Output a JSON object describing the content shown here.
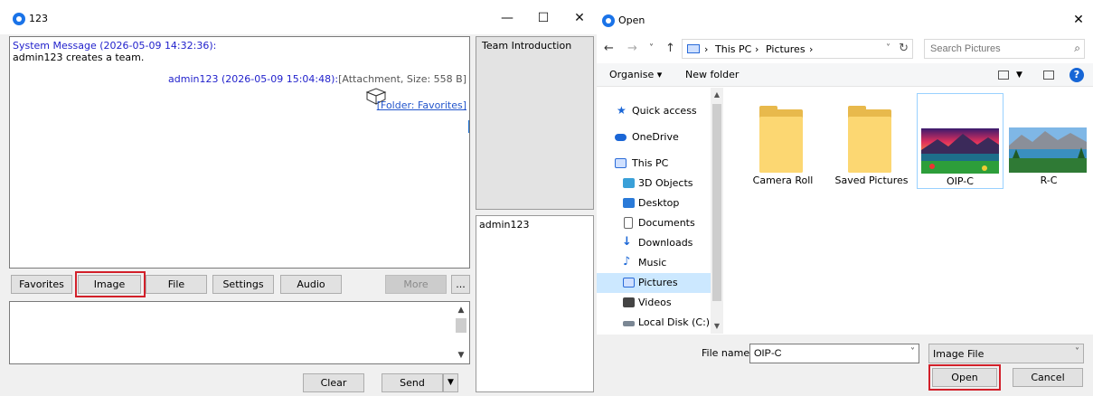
{
  "chat_window": {
    "title": "123",
    "controls": {
      "minimize": "—",
      "maximize": "☐",
      "close": "✕"
    },
    "messages": [
      {
        "header": "System Message (2026-05-09 14:32:36):",
        "body": "admin123 creates a team."
      },
      {
        "sender": "admin123 (2026-05-09 15:04:48):",
        "attachment": "[Attachment, Size: 558 B]",
        "link": "[Folder: Favorites]"
      }
    ],
    "toolbar": {
      "favorites": "Favorites",
      "image": "Image",
      "file": "File",
      "settings": "Settings",
      "audio": "Audio",
      "more": "More",
      "ellipsis": "..."
    },
    "buttons": {
      "clear": "Clear",
      "send": "Send",
      "send_dropdown": "▼"
    },
    "side_panel": {
      "top": "Team Introduction",
      "member": "admin123"
    },
    "highlight_color": "#d2202a"
  },
  "open_dialog": {
    "title": "Open",
    "close": "✕",
    "nav": {
      "back": "←",
      "forward": "→",
      "recent": "˅",
      "up": "↑"
    },
    "breadcrumb": [
      "This PC",
      "Pictures"
    ],
    "breadcrumb_sep": "›",
    "search_placeholder": "Search Pictures",
    "commands": {
      "organise": "Organise ▾",
      "new_folder": "New folder"
    },
    "tree": [
      {
        "label": "Quick access",
        "icon": "star-icon"
      },
      {
        "label": "OneDrive",
        "icon": "cloud-icon"
      },
      {
        "label": "This PC",
        "icon": "computer-icon"
      },
      {
        "label": "3D Objects",
        "icon": "cube-icon"
      },
      {
        "label": "Desktop",
        "icon": "desktop-icon"
      },
      {
        "label": "Documents",
        "icon": "document-icon"
      },
      {
        "label": "Downloads",
        "icon": "download-icon"
      },
      {
        "label": "Music",
        "icon": "music-icon"
      },
      {
        "label": "Pictures",
        "icon": "pictures-icon",
        "selected": true
      },
      {
        "label": "Videos",
        "icon": "video-icon"
      },
      {
        "label": "Local Disk (C:)",
        "icon": "disk-icon"
      }
    ],
    "files": [
      {
        "name": "Camera Roll",
        "kind": "folder"
      },
      {
        "name": "Saved Pictures",
        "kind": "folder"
      },
      {
        "name": "OIP-C",
        "kind": "image",
        "selected": true
      },
      {
        "name": "R-C",
        "kind": "image"
      }
    ],
    "file_name_label": "File name:",
    "file_name_value": "OIP-C",
    "file_type": "Image File",
    "open": "Open",
    "cancel": "Cancel"
  }
}
